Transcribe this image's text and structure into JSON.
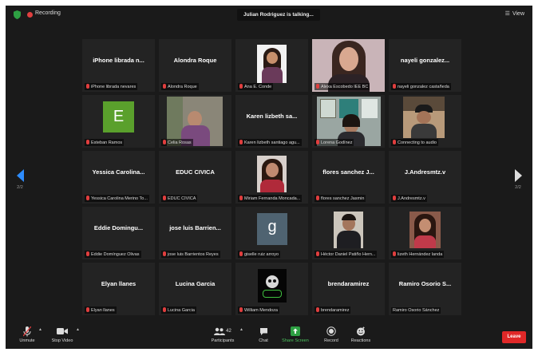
{
  "topbar": {
    "recording_label": "Recording",
    "talking_text": "Julian Rodriguez is talking...",
    "view_label": "View",
    "colors": {
      "recording": "#e04040",
      "shield": "#2ea043"
    }
  },
  "pager": {
    "left_text": "2/2",
    "right_text": "2/2",
    "accent": "#2d8cff"
  },
  "tiles": [
    {
      "name": "iPhone librada n...",
      "label": "iPhone librada nevares",
      "kind": "name"
    },
    {
      "name": "Alondra Roque",
      "label": "Alondra Roque",
      "kind": "name"
    },
    {
      "name": "",
      "label": "Ana E. Conde",
      "kind": "video"
    },
    {
      "name": "",
      "label": "Alexa Escobedo IEE BC",
      "kind": "video"
    },
    {
      "name": "nayeli gonzalez...",
      "label": "nayeli gonzalez castañeda",
      "kind": "name"
    },
    {
      "name": "E",
      "label": "Esteban Ramos",
      "kind": "avatar",
      "avatar_color": "#5aa02c"
    },
    {
      "name": "",
      "label": "Celia Rosas",
      "kind": "video"
    },
    {
      "name": "Karen lizbeth sa...",
      "label": "Karen lizbeth santiago agu...",
      "kind": "name"
    },
    {
      "name": "",
      "label": "Lorena Godínez",
      "kind": "video"
    },
    {
      "name": "",
      "label": "Connecting to audio",
      "kind": "video"
    },
    {
      "name": "Yessica Carolina...",
      "label": "Yessica Carolina Merino To...",
      "kind": "name"
    },
    {
      "name": "EDUC CIVICA",
      "label": "EDUC CIVICA",
      "kind": "name"
    },
    {
      "name": "",
      "label": "Miriam Fernanda Moncada...",
      "kind": "video"
    },
    {
      "name": "flores sanchez J...",
      "label": "flores sanchez Jasmin",
      "kind": "name"
    },
    {
      "name": "J.Andresmtz.v",
      "label": "J.Andresmtz.v",
      "kind": "name"
    },
    {
      "name": "Eddie Domingu...",
      "label": "Eddie Domínguez Olivas",
      "kind": "name"
    },
    {
      "name": "jose luis Barrien...",
      "label": "jose luis Barrientos Reyes",
      "kind": "name"
    },
    {
      "name": "g",
      "label": "giselle ruiz arroyo",
      "kind": "avatar",
      "avatar_color": "#4f6371"
    },
    {
      "name": "",
      "label": "Héctor Daniel Patiño Hern...",
      "kind": "video"
    },
    {
      "name": "",
      "label": "lizeth Hernández landa",
      "kind": "video"
    },
    {
      "name": "Elyan llanes",
      "label": "Elyan llanes",
      "kind": "name"
    },
    {
      "name": "Lucina Garcia",
      "label": "Lucina Garcia",
      "kind": "name"
    },
    {
      "name": "",
      "label": "William Mendoza",
      "kind": "video"
    },
    {
      "name": "brendaramirez",
      "label": "brendaramirez",
      "kind": "name"
    },
    {
      "name": "Ramiro Osorio S...",
      "label": "Ramiro Osorio Sánchez",
      "kind": "name"
    }
  ],
  "bottombar": {
    "unmute_label": "Unmute",
    "stop_video_label": "Stop Video",
    "participants_label": "Participants",
    "participants_count": "42",
    "chat_label": "Chat",
    "share_screen_label": "Share Screen",
    "record_label": "Record",
    "reactions_label": "Reactions",
    "leave_label": "Leave",
    "colors": {
      "share": "#2ea043",
      "leave": "#e02828"
    }
  }
}
